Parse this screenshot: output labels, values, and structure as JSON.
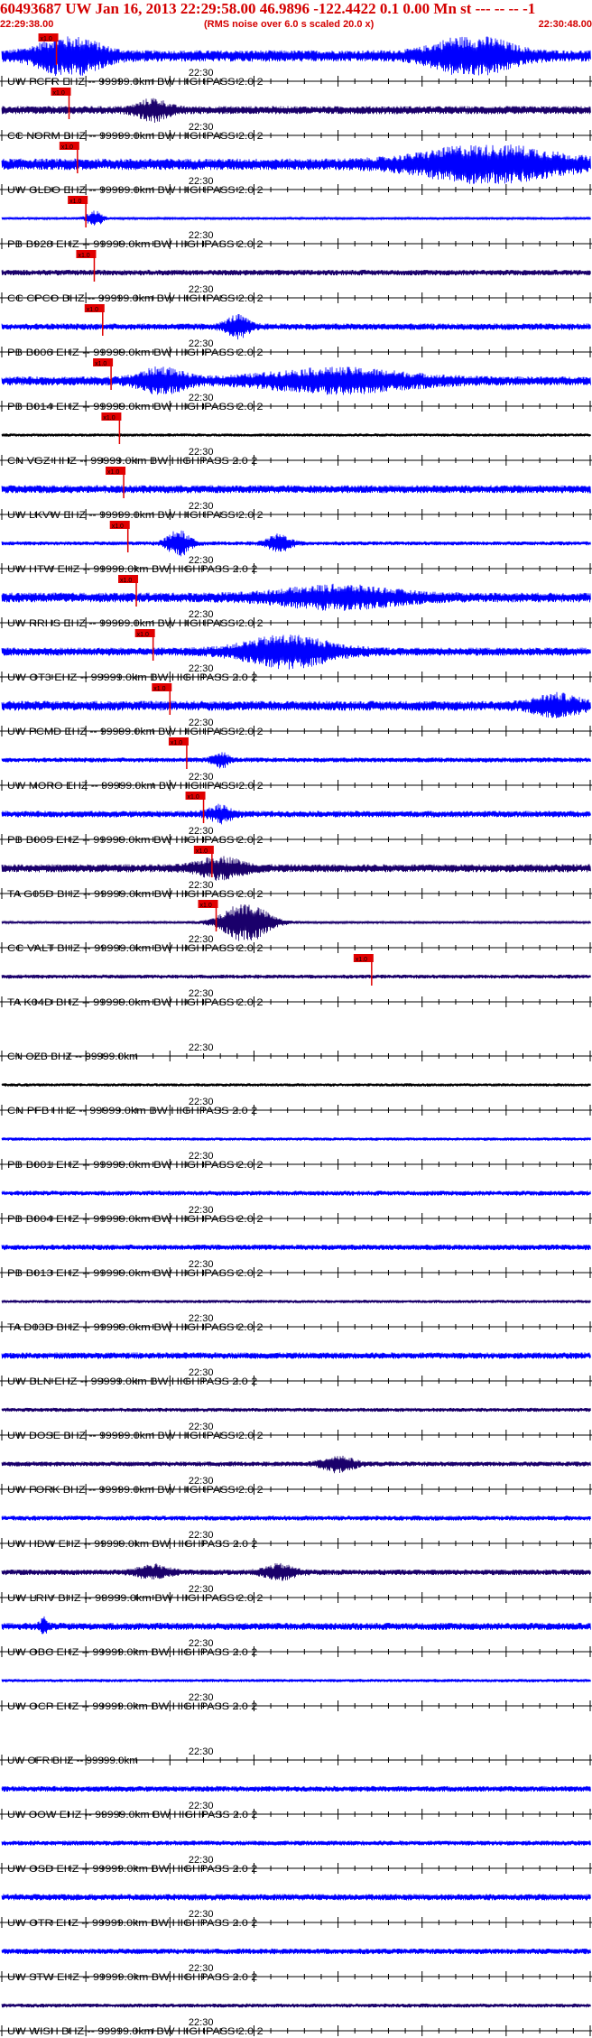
{
  "header": {
    "title": "60493687 UW Jan 16, 2013 22:29:58.00   46.9896 -122.4422  0.1 0.00 Mn st --- -- -- -1",
    "start_time": "22:29:38.00",
    "end_time": "22:30:48.00",
    "rms_note": "(RMS noise over 6.0 s scaled 20.0 x)"
  },
  "colors": {
    "header_text": "#d40000",
    "trace_blue": "#0000ff",
    "trace_navy": "#1a006b",
    "trace_black": "#000000",
    "pick": "#e00000",
    "axis": "#000000"
  },
  "chart_data": {
    "type": "line",
    "x_unit": "time (UTC)",
    "xlim": [
      "22:29:38.00",
      "22:30:48.00"
    ],
    "center_tick_label": "22:30",
    "pick_label": "x1.0",
    "stations": [
      {
        "label": "UW PCFR EHZ -- 99999.0km BW  HIGHPASS  2.0  2",
        "color": "#0000ff",
        "pick": "22:29:44.5",
        "amp": 0.7,
        "burst": [
          {
            "t": "22:29:46",
            "a": 2.2,
            "w": 4
          },
          {
            "t": "22:30:34",
            "a": 2.2,
            "w": 5
          }
        ]
      },
      {
        "label": "CC NORM BHZ -- 99999.0km BW  HIGHPASS  2.0  2",
        "color": "#1a006b",
        "pick": "22:29:46.0",
        "amp": 0.5,
        "burst": [
          {
            "t": "22:29:56",
            "a": 1.1,
            "w": 2
          }
        ]
      },
      {
        "label": "UW GLDO EHZ -- 99999.0km BW  HIGHPASS  2.0  2",
        "color": "#0000ff",
        "pick": "22:29:47.0",
        "amp": 0.7,
        "burst": [
          {
            "t": "22:30:36",
            "a": 2.0,
            "w": 9
          }
        ]
      },
      {
        "label": "PB B928 EHZ -- 99999.0km BW  HIGHPASS  2.0  2",
        "color": "#0000ff",
        "pick": "22:29:48.0",
        "amp": 0.15,
        "burst": [
          {
            "t": "22:29:49",
            "a": 0.9,
            "w": 1
          }
        ]
      },
      {
        "label": "CC CPCO BHZ -- 99999.0km BW  HIGHPASS  2.0  2",
        "color": "#1a006b",
        "pick": "22:29:49.0",
        "amp": 0.35,
        "burst": []
      },
      {
        "label": "PB B006 EHZ -- 99999.0km BW  HIGHPASS  2.0  2",
        "color": "#0000ff",
        "pick": "22:29:50.0",
        "amp": 0.4,
        "burst": [
          {
            "t": "22:30:06",
            "a": 1.2,
            "w": 1.5
          }
        ]
      },
      {
        "label": "PB B014 EHZ -- 99999.0km BW  HIGHPASS  2.0  2",
        "color": "#0000ff",
        "pick": "22:29:51.0",
        "amp": 0.55,
        "burst": [
          {
            "t": "22:29:57",
            "a": 1.3,
            "w": 3
          },
          {
            "t": "22:30:18",
            "a": 1.2,
            "w": 10
          }
        ]
      },
      {
        "label": "CN VGZ HHZ -- 99999.0km BW  HIGHPASS  2.0  2",
        "color": "#000000",
        "pick": "22:29:52.0",
        "amp": 0.2,
        "burst": []
      },
      {
        "label": "UW LKVW EHZ -- 99999.0km BW  HIGHPASS  2.0  2",
        "color": "#0000ff",
        "pick": "22:29:52.5",
        "amp": 0.5,
        "burst": []
      },
      {
        "label": "UW HTW EHZ -- 99999.0km BW  HIGHPASS  2.0  2",
        "color": "#0000ff",
        "pick": "22:29:53.0",
        "amp": 0.25,
        "burst": [
          {
            "t": "22:29:59",
            "a": 1.5,
            "w": 1.5
          },
          {
            "t": "22:30:11",
            "a": 1.0,
            "w": 1.5
          }
        ]
      },
      {
        "label": "UW RRHS EHZ -- 99999.0km BW  HIGHPASS  2.0  2",
        "color": "#0000ff",
        "pick": "22:29:54.0",
        "amp": 0.6,
        "burst": [
          {
            "t": "22:30:18",
            "a": 1.1,
            "w": 8
          }
        ]
      },
      {
        "label": "UW OT3 EHZ -- 99999.0km BW  HIGHPASS  2.0  2",
        "color": "#0000ff",
        "pick": "22:29:56.0",
        "amp": 0.5,
        "burst": [
          {
            "t": "22:30:12",
            "a": 1.7,
            "w": 6
          }
        ]
      },
      {
        "label": "UW PCMD EHZ -- 99999.0km BW  HIGHPASS  2.0  2",
        "color": "#0000ff",
        "pick": "22:29:58.0",
        "amp": 0.6,
        "burst": [
          {
            "t": "22:30:44",
            "a": 1.1,
            "w": 3
          }
        ]
      },
      {
        "label": "UW MORO EHZ -- 99999.0km BW  HIGHPASS  2.0  2",
        "color": "#0000ff",
        "pick": "22:30:00.0",
        "amp": 0.3,
        "burst": [
          {
            "t": "22:30:04",
            "a": 0.9,
            "w": 1
          }
        ]
      },
      {
        "label": "PB B005 EHZ -- 99999.0km BW  HIGHPASS  2.0  2",
        "color": "#0000ff",
        "pick": "22:30:02.0",
        "amp": 0.4,
        "burst": [
          {
            "t": "22:30:04",
            "a": 0.9,
            "w": 1.5
          }
        ]
      },
      {
        "label": "TA G05D BHZ -- 99999.0km BW  HIGHPASS  2.0  2",
        "color": "#1a006b",
        "pick": "22:30:03.0",
        "amp": 0.5,
        "burst": [
          {
            "t": "22:30:04",
            "a": 1.1,
            "w": 3
          }
        ]
      },
      {
        "label": "CC VALT BHZ -- 99999.0km BW  HIGHPASS  2.0  2",
        "color": "#1a006b",
        "pick": "22:30:03.5",
        "amp": 0.15,
        "burst": [
          {
            "t": "22:30:07",
            "a": 2.4,
            "w": 3
          }
        ]
      },
      {
        "label": "TA K04D BHZ -- 99999.0km BW  HIGHPASS  2.0  2",
        "color": "#1a006b",
        "pick": "22:30:22.0",
        "amp": 0.25,
        "burst": []
      },
      {
        "label": "CN OZB BHZ -- 99999.0km",
        "color": "#000000",
        "pick": null,
        "amp": 0.0,
        "burst": []
      },
      {
        "label": "CN PFB HHZ -- 99999.0km BW  HIGHPASS  2.0  2",
        "color": "#000000",
        "pick": null,
        "amp": 0.2,
        "burst": []
      },
      {
        "label": "PB B001 EHZ -- 99999.0km BW  HIGHPASS  2.0  2",
        "color": "#0000ff",
        "pick": null,
        "amp": 0.2,
        "burst": []
      },
      {
        "label": "PB B004 EHZ -- 99999.0km BW  HIGHPASS  2.0  2",
        "color": "#0000ff",
        "pick": null,
        "amp": 0.3,
        "burst": []
      },
      {
        "label": "PB B013 EHZ -- 99999.0km BW  HIGHPASS  2.0  2",
        "color": "#0000ff",
        "pick": null,
        "amp": 0.35,
        "burst": []
      },
      {
        "label": "TA D03D BHZ -- 99999.0km BW  HIGHPASS  2.0  2",
        "color": "#1a006b",
        "pick": null,
        "amp": 0.2,
        "burst": []
      },
      {
        "label": "UW BLN EHZ -- 99999.0km BW  HIGHPASS  2.0  2",
        "color": "#0000ff",
        "pick": null,
        "amp": 0.4,
        "burst": []
      },
      {
        "label": "UW DOSE BHZ -- 99999.0km BW  HIGHPASS  2.0  2",
        "color": "#1a006b",
        "pick": null,
        "amp": 0.25,
        "burst": []
      },
      {
        "label": "UW FORK BHZ -- 99999.0km BW  HIGHPASS  2.0  2",
        "color": "#1a006b",
        "pick": null,
        "amp": 0.3,
        "burst": [
          {
            "t": "22:30:18",
            "a": 0.9,
            "w": 2
          }
        ]
      },
      {
        "label": "UW HDW EHZ -- 99999.0km BW  HIGHPASS  2.0  2",
        "color": "#0000ff",
        "pick": null,
        "amp": 0.3,
        "burst": []
      },
      {
        "label": "UW LRIV BHZ -- 99999.0km BW  HIGHPASS  2.0  2",
        "color": "#1a006b",
        "pick": null,
        "amp": 0.35,
        "burst": [
          {
            "t": "22:29:56",
            "a": 0.8,
            "w": 2
          },
          {
            "t": "22:30:11",
            "a": 0.8,
            "w": 2
          }
        ]
      },
      {
        "label": "UW OBC EHZ -- 99999.0km BW  HIGHPASS  2.0  2",
        "color": "#0000ff",
        "pick": null,
        "amp": 0.45,
        "burst": [
          {
            "t": "22:29:43",
            "a": 0.8,
            "w": 0.5
          }
        ]
      },
      {
        "label": "UW OCP EHZ -- 99999.0km BW  HIGHPASS  2.0  2",
        "color": "#0000ff",
        "pick": null,
        "amp": 0.2,
        "burst": []
      },
      {
        "label": "UW OFR BHZ -- 99999.0km",
        "color": "#000000",
        "pick": null,
        "amp": 0.0,
        "burst": []
      },
      {
        "label": "UW OOW EHZ -- 99999.0km BW  HIGHPASS  2.0  2",
        "color": "#0000ff",
        "pick": null,
        "amp": 0.35,
        "burst": []
      },
      {
        "label": "UW OSD EHZ -- 99999.0km BW  HIGHPASS  2.0  2",
        "color": "#0000ff",
        "pick": null,
        "amp": 0.3,
        "burst": []
      },
      {
        "label": "UW OTR EHZ -- 99999.0km BW  HIGHPASS  2.0  2",
        "color": "#0000ff",
        "pick": null,
        "amp": 0.4,
        "burst": []
      },
      {
        "label": "UW STW EHZ -- 99999.0km BW  HIGHPASS  2.0  2",
        "color": "#0000ff",
        "pick": null,
        "amp": 0.35,
        "burst": []
      },
      {
        "label": "UW WISH BHZ -- 99999.0km BW  HIGHPASS  2.0  2",
        "color": "#1a006b",
        "pick": null,
        "amp": 0.25,
        "burst": []
      }
    ]
  }
}
